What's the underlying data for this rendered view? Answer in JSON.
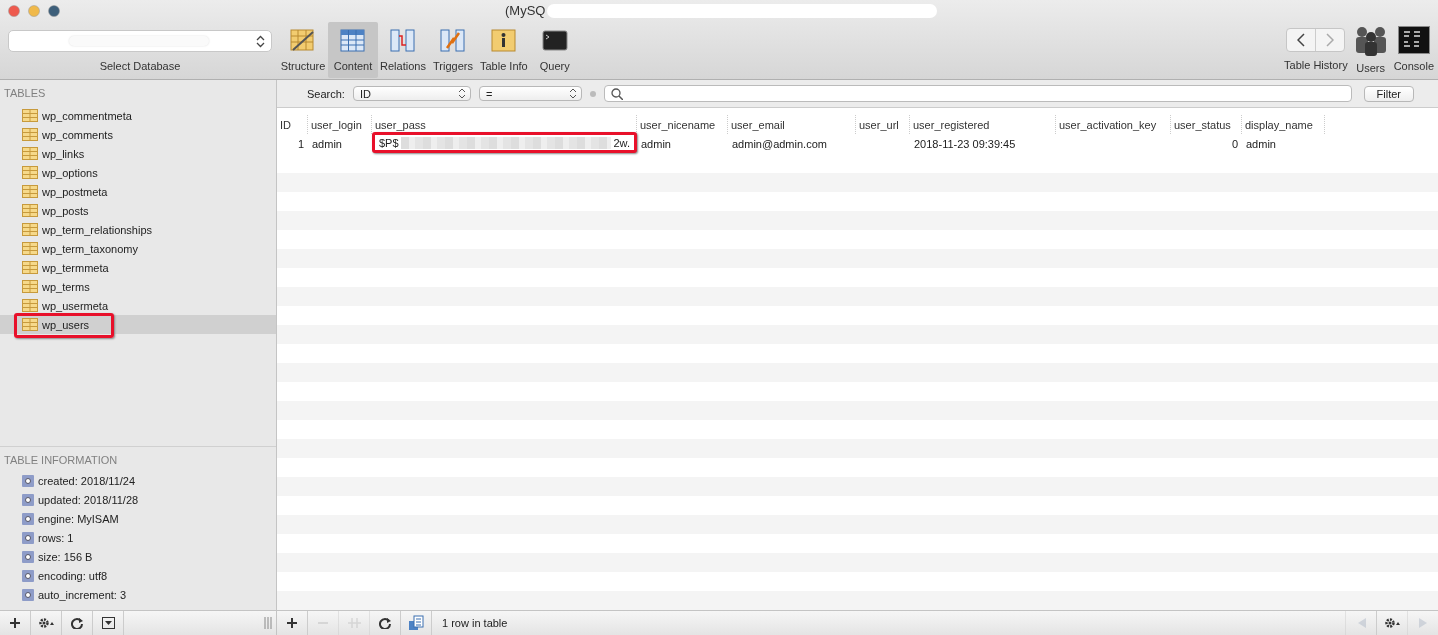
{
  "window": {
    "title": "(MySQ"
  },
  "database_select": {
    "label": "Select Database"
  },
  "toolbar": [
    {
      "kind": "structure",
      "label": "Structure",
      "selected": false
    },
    {
      "kind": "content",
      "label": "Content",
      "selected": true
    },
    {
      "kind": "relations",
      "label": "Relations",
      "selected": false
    },
    {
      "kind": "triggers",
      "label": "Triggers",
      "selected": false
    },
    {
      "kind": "info",
      "label": "Table Info",
      "selected": false
    },
    {
      "kind": "query",
      "label": "Query",
      "selected": false
    }
  ],
  "right_toolbar": {
    "history_label": "Table History",
    "users_label": "Users",
    "console_label": "Console"
  },
  "sidebar": {
    "heading": "TABLES",
    "tables": [
      {
        "name": "wp_commentmeta",
        "selected": false,
        "highlighted": false
      },
      {
        "name": "wp_comments",
        "selected": false,
        "highlighted": false
      },
      {
        "name": "wp_links",
        "selected": false,
        "highlighted": false
      },
      {
        "name": "wp_options",
        "selected": false,
        "highlighted": false
      },
      {
        "name": "wp_postmeta",
        "selected": false,
        "highlighted": false
      },
      {
        "name": "wp_posts",
        "selected": false,
        "highlighted": false
      },
      {
        "name": "wp_term_relationships",
        "selected": false,
        "highlighted": false
      },
      {
        "name": "wp_term_taxonomy",
        "selected": false,
        "highlighted": false
      },
      {
        "name": "wp_termmeta",
        "selected": false,
        "highlighted": false
      },
      {
        "name": "wp_terms",
        "selected": false,
        "highlighted": false
      },
      {
        "name": "wp_usermeta",
        "selected": false,
        "highlighted": false
      },
      {
        "name": "wp_users",
        "selected": true,
        "highlighted": true
      }
    ],
    "info_heading": "TABLE INFORMATION",
    "info": [
      "created: 2018/11/24",
      "updated: 2018/11/28",
      "engine: MyISAM",
      "rows: 1",
      "size: 156 B",
      "encoding: utf8",
      "auto_increment: 3"
    ]
  },
  "search": {
    "label": "Search:",
    "field": "ID",
    "operator": "=",
    "button": "Filter"
  },
  "table": {
    "columns": [
      {
        "name": "ID"
      },
      {
        "name": "user_login"
      },
      {
        "name": "user_pass"
      },
      {
        "name": "user_nicename"
      },
      {
        "name": "user_email"
      },
      {
        "name": "user_url"
      },
      {
        "name": "user_registered"
      },
      {
        "name": "user_activation_key"
      },
      {
        "name": "user_status"
      },
      {
        "name": "display_name"
      }
    ],
    "rows": [
      {
        "cells": [
          {
            "kind": "number",
            "text": "1",
            "highlighted": false
          },
          {
            "kind": "text",
            "text": "admin",
            "highlighted": false
          },
          {
            "kind": "masked",
            "start": "$P$",
            "end": "2w.",
            "highlighted": true
          },
          {
            "kind": "text",
            "text": "admin",
            "highlighted": false
          },
          {
            "kind": "text",
            "text": "admin@admin.com",
            "highlighted": false
          },
          {
            "kind": "empty",
            "highlighted": false
          },
          {
            "kind": "text",
            "text": "2018-11-23 09:39:45",
            "highlighted": false
          },
          {
            "kind": "empty",
            "highlighted": false
          },
          {
            "kind": "number",
            "text": "0",
            "highlighted": false
          },
          {
            "kind": "text",
            "text": "admin",
            "highlighted": false
          }
        ]
      }
    ]
  },
  "sidebar_actions": [
    {
      "kind": "add",
      "disabled": false
    },
    {
      "kind": "gear",
      "disabled": false
    },
    {
      "kind": "refresh",
      "disabled": false
    },
    {
      "kind": "dropdown",
      "disabled": false
    }
  ],
  "row_actions": [
    {
      "kind": "add",
      "disabled": false
    },
    {
      "kind": "remove",
      "disabled": true
    },
    {
      "kind": "duplicate",
      "disabled": true
    },
    {
      "kind": "refresh",
      "disabled": false
    },
    {
      "kind": "copy",
      "disabled": false
    }
  ],
  "status_bar": {
    "text": "1 row in table"
  },
  "pager": [
    {
      "kind": "previous",
      "disabled": true
    },
    {
      "kind": "gear",
      "disabled": false
    },
    {
      "kind": "next",
      "disabled": true
    }
  ]
}
